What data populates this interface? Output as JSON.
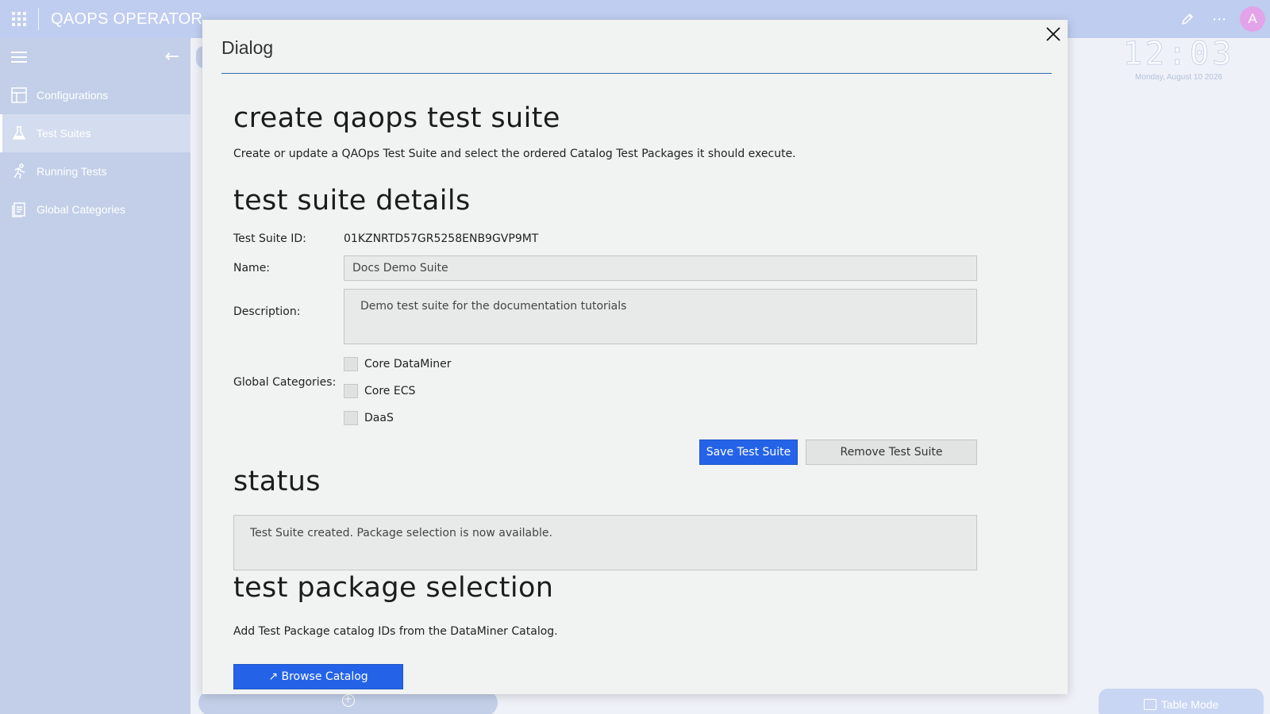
{
  "app": {
    "title": "QAOPS OPERATOR",
    "avatar_initial": "A"
  },
  "sidebar": {
    "items": [
      {
        "label": "Configurations",
        "icon": "layout-icon",
        "active": false
      },
      {
        "label": "Test Suites",
        "icon": "flask-icon",
        "active": true
      },
      {
        "label": "Running Tests",
        "icon": "running-icon",
        "active": false
      },
      {
        "label": "Global Categories",
        "icon": "document-icon",
        "active": false
      }
    ]
  },
  "background": {
    "clock_time": "12:03",
    "clock_date": "Monday, August 10 2026",
    "table_mode_label": "Table Mode"
  },
  "dialog": {
    "title": "Dialog",
    "create_heading": "create qaops test suite",
    "create_description": "Create or update a QAOps Test Suite and select the ordered Catalog Test Packages it should execute.",
    "details_heading": "test suite details",
    "id_label": "Test Suite ID:",
    "id_value": "01KZNRTD57GR5258ENB9GVP9MT",
    "name_label": "Name:",
    "name_value": "Docs Demo Suite",
    "description_label": "Description:",
    "description_value": "Demo test suite for the documentation tutorials",
    "categories_label": "Global Categories:",
    "categories": [
      {
        "label": "Core DataMiner",
        "checked": false
      },
      {
        "label": "Core ECS",
        "checked": false
      },
      {
        "label": "DaaS",
        "checked": false
      }
    ],
    "save_label": "Save Test Suite",
    "remove_label": "Remove Test Suite",
    "status_heading": "status",
    "status_text": "Test Suite created. Package selection is now available.",
    "package_heading": "test package selection",
    "package_description": "Add Test Package catalog IDs from the DataMiner Catalog.",
    "browse_label": "↗ Browse Catalog"
  },
  "colors": {
    "primary": "#2463e8",
    "topbar": "#bfcdf0",
    "sidebar": "#c3cfe8",
    "divider": "#2f6fb7"
  }
}
